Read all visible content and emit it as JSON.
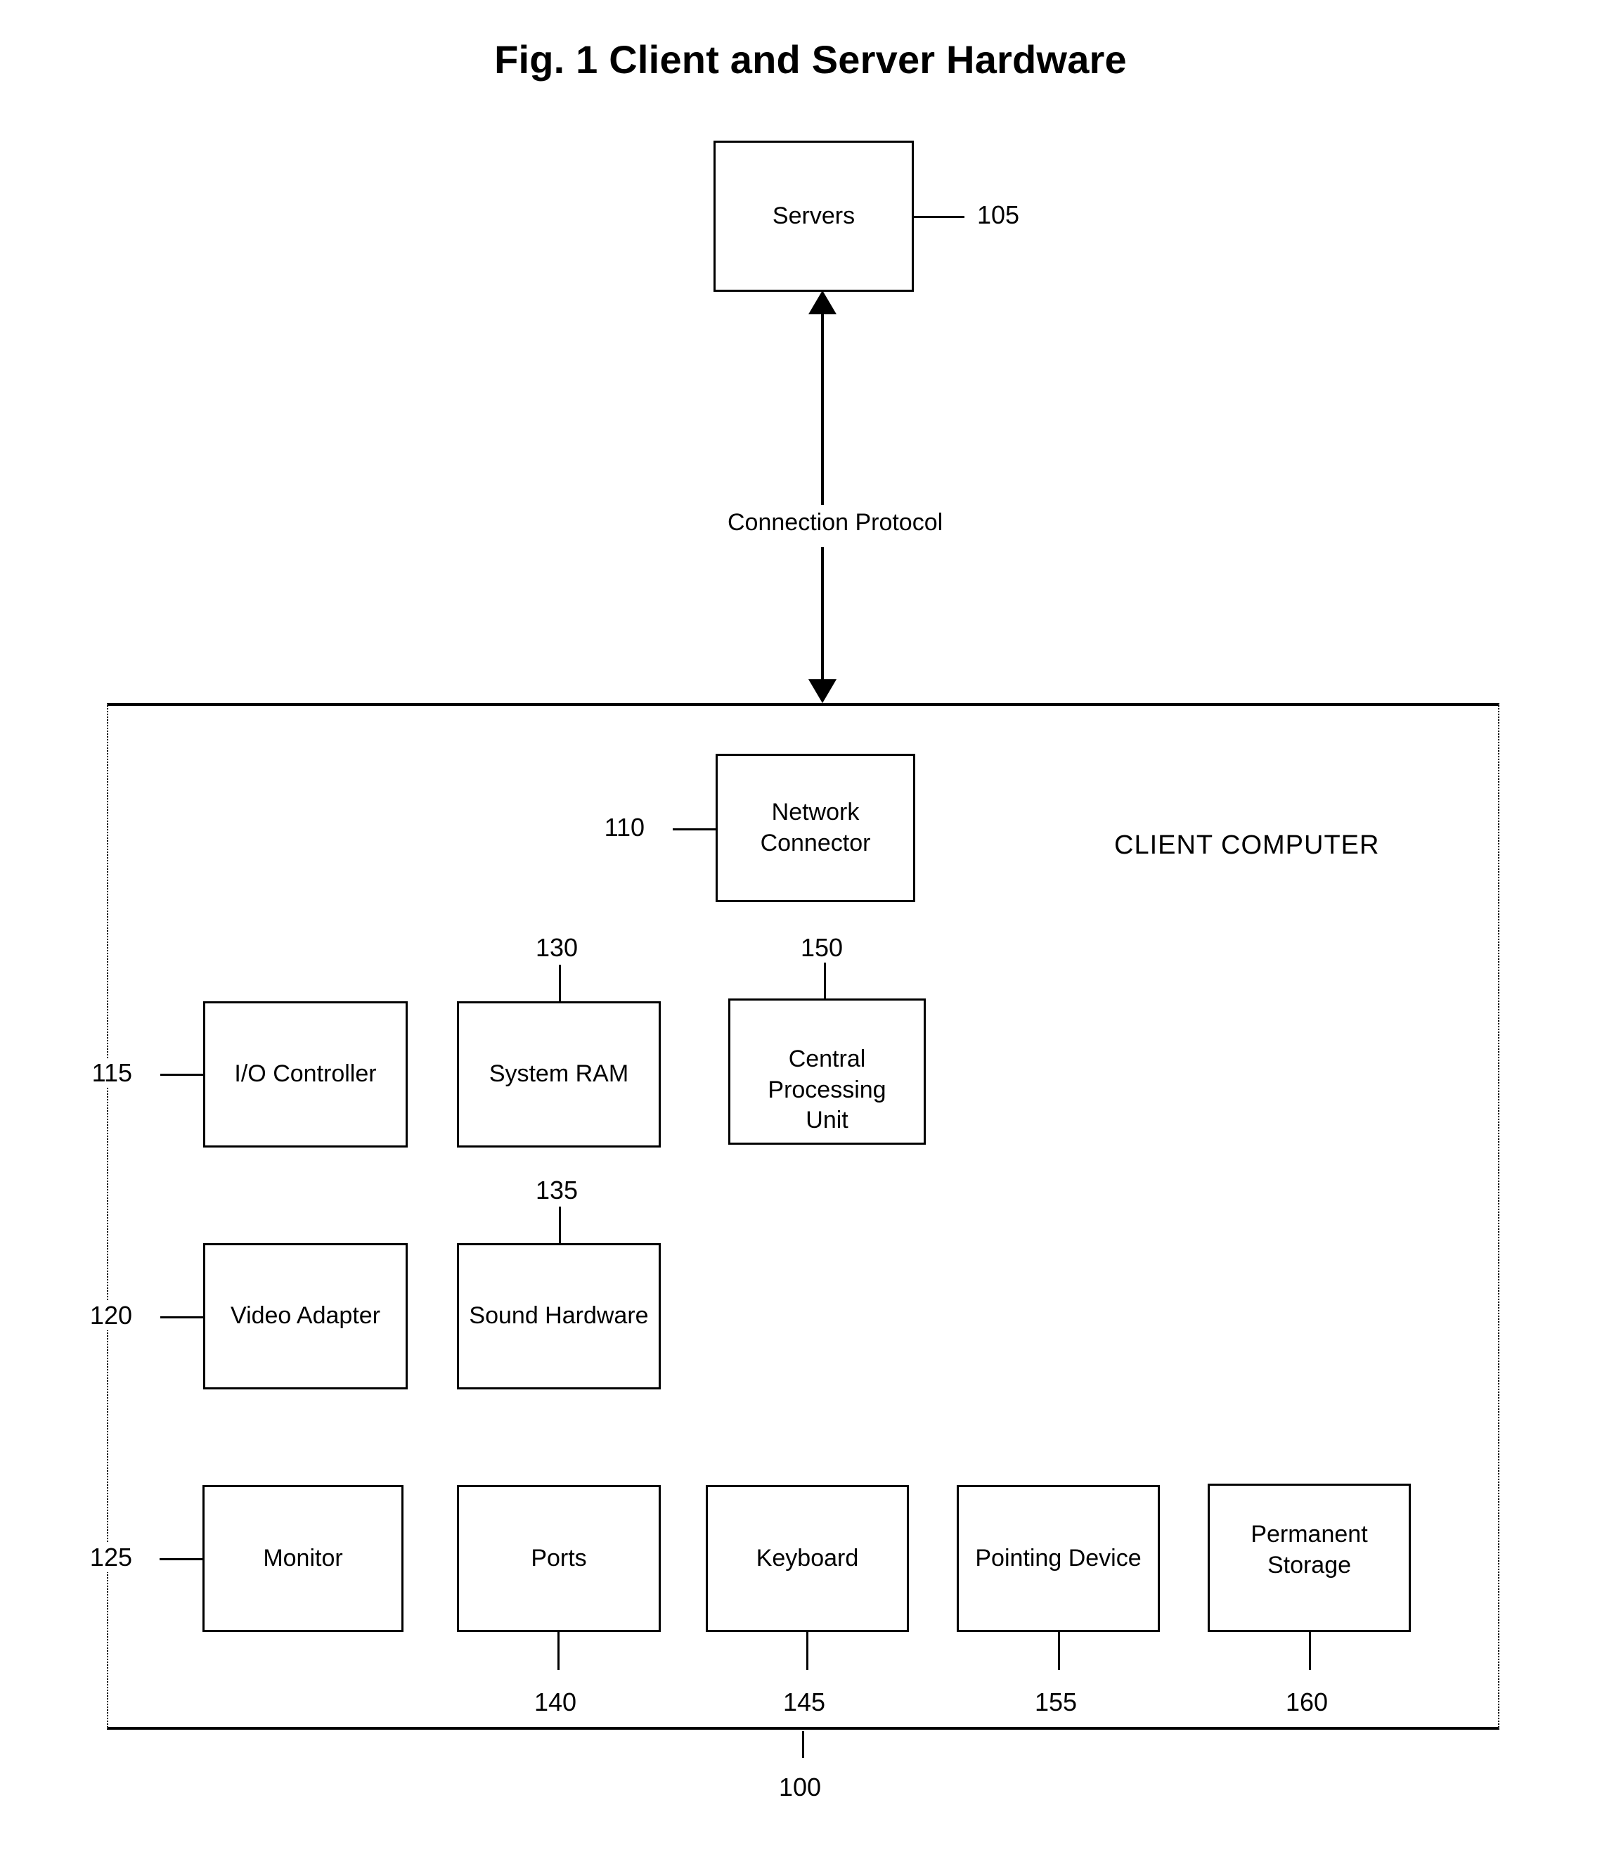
{
  "figure": {
    "title": "Fig. 1 Client and Server Hardware",
    "client_computer_caption": "CLIENT COMPUTER",
    "connection_caption": "Connection Protocol",
    "container_ref": "100"
  },
  "nodes": {
    "servers": {
      "label": "Servers",
      "ref": "105"
    },
    "network_connector": {
      "label": "Network\nConnector",
      "ref": "110",
      "line1": "Network",
      "line2": "Connector"
    },
    "io_controller": {
      "label": "I/O Controller",
      "ref": "115"
    },
    "video_adapter": {
      "label": "Video Adapter",
      "ref": "120"
    },
    "monitor": {
      "label": "Monitor",
      "ref": "125"
    },
    "system_ram": {
      "label": "System RAM",
      "ref": "130"
    },
    "sound_hardware": {
      "label": "Sound Hardware",
      "ref": "135"
    },
    "ports": {
      "label": "Ports",
      "ref": "140"
    },
    "keyboard": {
      "label": "Keyboard",
      "ref": "145"
    },
    "cpu": {
      "label": "Central Processing Unit",
      "ref": "150",
      "line1": "Central Processing",
      "line2": "Unit"
    },
    "pointing_device": {
      "label": "Pointing Device",
      "ref": "155"
    },
    "permanent_storage": {
      "label": "Permanent Storage",
      "ref": "160",
      "line1": "Permanent",
      "line2": "Storage"
    }
  },
  "colors": {
    "stroke": "#000000",
    "background": "#ffffff",
    "text": "#000000"
  }
}
